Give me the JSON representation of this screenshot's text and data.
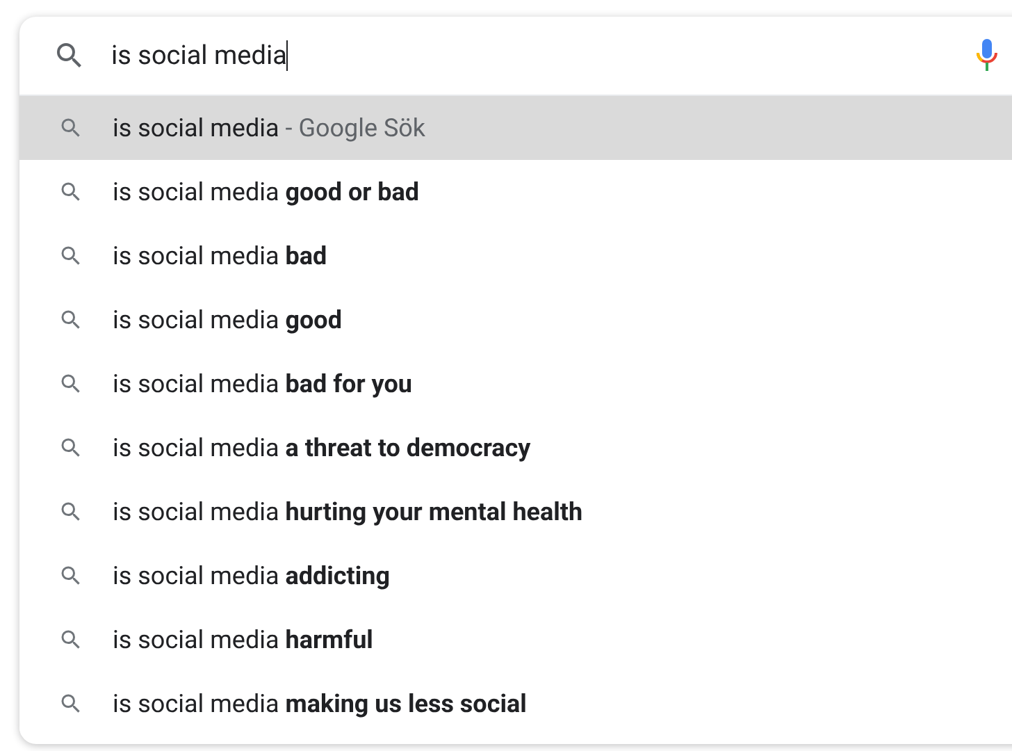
{
  "search": {
    "value": "is social media"
  },
  "suggestions": [
    {
      "text": "is social media",
      "hint": "- Google Sök",
      "selected": true
    },
    {
      "text": "is social media **good or bad**",
      "selected": false
    },
    {
      "text": "is social media **bad**",
      "selected": false
    },
    {
      "text": "is social media **good**",
      "selected": false
    },
    {
      "text": "is social media **bad for you**",
      "selected": false
    },
    {
      "text": "is social media **a threat to democracy**",
      "selected": false
    },
    {
      "text": "is social media **hurting your mental health**",
      "selected": false
    },
    {
      "text": "is social media **addicting**",
      "selected": false
    },
    {
      "text": "is social media **harmful**",
      "selected": false
    },
    {
      "text": "is social media **making us less social**",
      "selected": false
    }
  ]
}
